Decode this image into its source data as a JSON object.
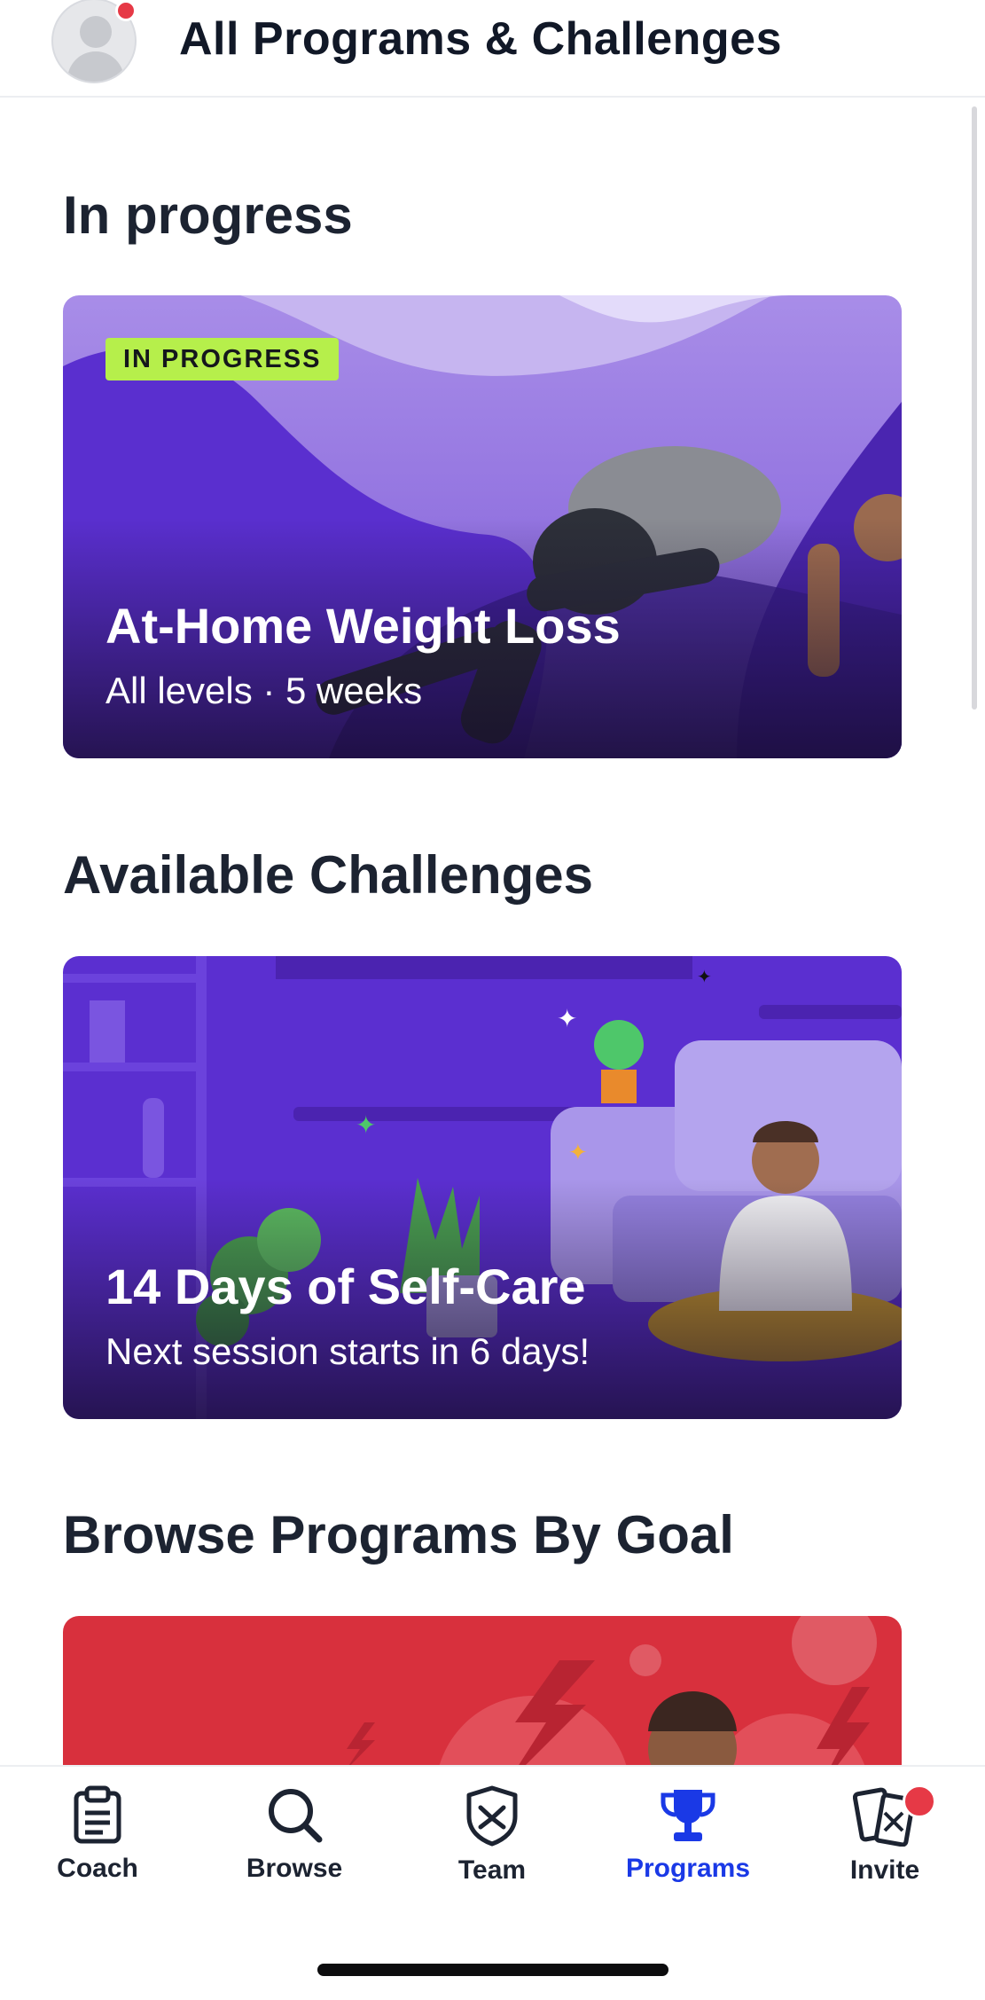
{
  "header": {
    "title": "All Programs & Challenges"
  },
  "sections": {
    "in_progress": {
      "title": "In progress",
      "card": {
        "badge": "IN PROGRESS",
        "title": "At-Home Weight Loss",
        "subtitle": "All levels · 5 weeks"
      }
    },
    "challenges": {
      "title": "Available Challenges",
      "card": {
        "title": "14 Days of Self-Care",
        "subtitle": "Next session starts in 6 days!"
      }
    },
    "browse": {
      "title": "Browse Programs By Goal"
    }
  },
  "tabs": [
    {
      "label": "Coach",
      "icon": "clipboard-icon"
    },
    {
      "label": "Browse",
      "icon": "search-icon"
    },
    {
      "label": "Team",
      "icon": "shield-icon"
    },
    {
      "label": "Programs",
      "icon": "trophy-icon",
      "active": true
    },
    {
      "label": "Invite",
      "icon": "invite-cards-icon"
    }
  ],
  "colors": {
    "accent": "#1a39e6",
    "badge": "#b6ef4b",
    "notification": "#e63946",
    "card_purple": "#5b2fd0",
    "card_red": "#d8303d"
  }
}
